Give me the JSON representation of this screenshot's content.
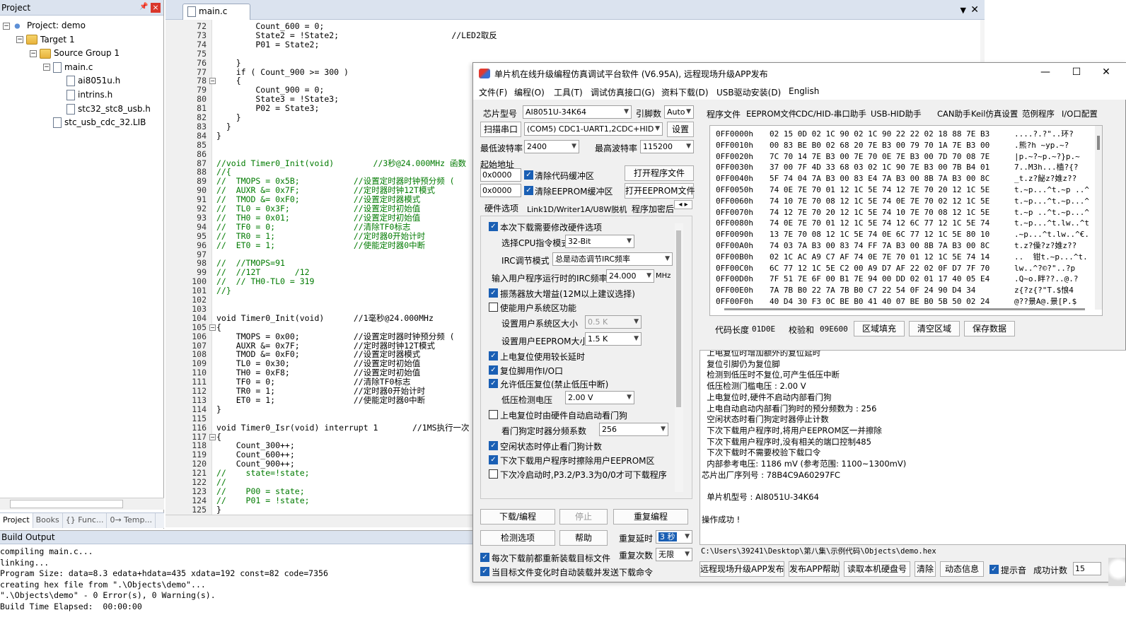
{
  "project_panel": {
    "title": "Project",
    "tree": [
      {
        "label": "Project: demo",
        "indent": 0,
        "exp": "−",
        "icon": "proj"
      },
      {
        "label": "Target 1",
        "indent": 1,
        "exp": "−",
        "icon": "folder"
      },
      {
        "label": "Source Group 1",
        "indent": 2,
        "exp": "−",
        "icon": "folder"
      },
      {
        "label": "main.c",
        "indent": 3,
        "exp": "−",
        "icon": "file"
      },
      {
        "label": "ai8051u.h",
        "indent": 4,
        "exp": "",
        "icon": "file"
      },
      {
        "label": "intrins.h",
        "indent": 4,
        "exp": "",
        "icon": "file"
      },
      {
        "label": "stc32_stc8_usb.h",
        "indent": 4,
        "exp": "",
        "icon": "file"
      },
      {
        "label": "stc_usb_cdc_32.LIB",
        "indent": 3,
        "exp": "",
        "icon": "file"
      }
    ],
    "tabs": [
      "Project",
      "Books",
      "{} Func...",
      "0→ Temp..."
    ]
  },
  "editor": {
    "tab": "main.c",
    "lines": [
      {
        "n": 72,
        "t": "        Count_600 = 0;"
      },
      {
        "n": 73,
        "t": "        State2 = !State2;                       //LED2取反",
        "c": 1
      },
      {
        "n": 74,
        "t": "        P01 = State2;"
      },
      {
        "n": 75,
        "t": ""
      },
      {
        "n": 76,
        "t": "    }"
      },
      {
        "n": 77,
        "t": "    if ( Count_900 >= 300 )",
        "k": 1
      },
      {
        "n": 78,
        "t": "    {",
        "f": 1
      },
      {
        "n": 79,
        "t": "        Count_900 = 0;"
      },
      {
        "n": 80,
        "t": "        State3 = !State3;"
      },
      {
        "n": 81,
        "t": "        P02 = State3;"
      },
      {
        "n": 82,
        "t": "    }"
      },
      {
        "n": 83,
        "t": "  }"
      },
      {
        "n": 84,
        "t": "}"
      },
      {
        "n": 85,
        "t": ""
      },
      {
        "n": 86,
        "t": ""
      },
      {
        "n": 87,
        "t": "//void Timer0_Init(void)        //3秒@24.000MHz 函数",
        "c": 2
      },
      {
        "n": 88,
        "t": "//{",
        "c": 2
      },
      {
        "n": 89,
        "t": "//  TMOPS = 0x5B;           //设置定时器时钟预分频 ( ",
        "c": 2
      },
      {
        "n": 90,
        "t": "//  AUXR &= 0x7F;           //定时器时钟12T模式",
        "c": 2
      },
      {
        "n": 91,
        "t": "//  TMOD &= 0xF0;           //设置定时器模式",
        "c": 2
      },
      {
        "n": 92,
        "t": "//  TL0 = 0x3F;             //设置定时初始值",
        "c": 2
      },
      {
        "n": 93,
        "t": "//  TH0 = 0x01;             //设置定时初始值",
        "c": 2
      },
      {
        "n": 94,
        "t": "//  TF0 = 0;                //清除TF0标志",
        "c": 2
      },
      {
        "n": 95,
        "t": "//  TR0 = 1;                //定时器0开始计时",
        "c": 2
      },
      {
        "n": 96,
        "t": "//  ET0 = 1;                //使能定时器0中断",
        "c": 2
      },
      {
        "n": 97,
        "t": ""
      },
      {
        "n": 98,
        "t": "//  //TMOPS=91",
        "c": 2
      },
      {
        "n": 99,
        "t": "//  //12T       /12",
        "c": 2
      },
      {
        "n": 100,
        "t": "//  // TH0-TL0 = 319",
        "c": 2
      },
      {
        "n": 101,
        "t": "//}",
        "c": 2
      },
      {
        "n": 102,
        "t": ""
      },
      {
        "n": 103,
        "t": ""
      },
      {
        "n": 104,
        "t": "void Timer0_Init(void)      //1毫秒@24.000MHz",
        "k": 2
      },
      {
        "n": 105,
        "t": "{",
        "f": 1
      },
      {
        "n": 106,
        "t": "    TMOPS = 0x00;           //设置定时器时钟预分频 ( ",
        "c": 1
      },
      {
        "n": 107,
        "t": "    AUXR &= 0x7F;           //定时器时钟12T模式",
        "c": 1
      },
      {
        "n": 108,
        "t": "    TMOD &= 0xF0;           //设置定时器模式",
        "c": 1
      },
      {
        "n": 109,
        "t": "    TL0 = 0x30;             //设置定时初始值",
        "c": 1
      },
      {
        "n": 110,
        "t": "    TH0 = 0xF8;             //设置定时初始值",
        "c": 1
      },
      {
        "n": 111,
        "t": "    TF0 = 0;                //清除TF0标志",
        "c": 1
      },
      {
        "n": 112,
        "t": "    TR0 = 1;                //定时器0开始计时",
        "c": 1
      },
      {
        "n": 113,
        "t": "    ET0 = 1;                //使能定时器0中断",
        "c": 1
      },
      {
        "n": 114,
        "t": "}"
      },
      {
        "n": 115,
        "t": ""
      },
      {
        "n": 116,
        "t": "void Timer0_Isr(void) interrupt 1       //1MS执行一次",
        "k": 2
      },
      {
        "n": 117,
        "t": "{",
        "f": 1
      },
      {
        "n": 118,
        "t": "    Count_300++;"
      },
      {
        "n": 119,
        "t": "    Count_600++;"
      },
      {
        "n": 120,
        "t": "    Count_900++;"
      },
      {
        "n": 121,
        "t": "//    state=!state;",
        "c": 2
      },
      {
        "n": 122,
        "t": "//",
        "c": 2
      },
      {
        "n": 123,
        "t": "//    P00 = state;",
        "c": 2
      },
      {
        "n": 124,
        "t": "//    P01 = !state;",
        "c": 2
      },
      {
        "n": 125,
        "t": "}"
      }
    ]
  },
  "build": {
    "title": "Build Output",
    "lines": [
      "compiling main.c...",
      "linking...",
      "Program Size: data=8.3 edata+hdata=435 xdata=192 const=82 code=7356",
      "creating hex file from \".\\Objects\\demo\"...",
      "\".\\Objects\\demo\" - 0 Error(s), 0 Warning(s).",
      "Build Time Elapsed:  00:00:00"
    ]
  },
  "isp": {
    "title": "单片机在线升级编程仿真调试平台软件 (V6.95A), 远程现场升级APP发布",
    "menu": [
      "文件(F)",
      "编程(O)",
      "工具(T)",
      "调试仿真接口(G)",
      "资料下载(D)",
      "USB驱动安装(D)",
      "English"
    ],
    "chip_label": "芯片型号",
    "chip_value": "AI8051U-34K64",
    "pin_label": "引脚数",
    "pin_value": "Auto",
    "scan_btn": "扫描串口",
    "port_value": "(COM5) CDC1-UART1,2CDC+HID",
    "settings_btn": "设置",
    "min_baud_label": "最低波特率",
    "min_baud_value": "2400",
    "max_baud_label": "最高波特率",
    "max_baud_value": "115200",
    "start_addr_label": "起始地址",
    "addr1": "0x0000",
    "addr2": "0x0000",
    "clear_code": "清除代码缓冲区",
    "clear_eeprom": "清除EEPROM缓冲区",
    "open_prog_btn": "打开程序文件",
    "open_eeprom_btn": "打开EEPROM文件",
    "hw_tabs": [
      "硬件选项",
      "Link1D/Writer1A/U8W脱机",
      "程序加密后"
    ],
    "opt_modify_hw": "本次下载需要修改硬件选项",
    "cpu_mode_label": "选择CPU指令模式",
    "cpu_mode_value": "32-Bit",
    "irc_mode_label": "IRC调节模式",
    "irc_mode_value": "总是动态调节IRC频率",
    "irc_freq_label": "输入用户程序运行时的IRC频率",
    "irc_freq_value": "24.000",
    "irc_freq_unit": "MHz",
    "osc_gain": "振荡器放大增益(12M以上建议选择)",
    "user_sys_area": "使能用户系统区功能",
    "sys_area_size_label": "设置用户系统区大小",
    "sys_area_size_value": "0.5 K",
    "eeprom_size_label": "设置用户EEPROM大小",
    "eeprom_size_value": "1.5 K",
    "long_reset": "上电复位使用较长延时",
    "reset_io": "复位脚用作I/O口",
    "lvr": "允许低压复位(禁止低压中断)",
    "lvd_label": "低压检测电压",
    "lvd_value": "2.00 V",
    "wdt_auto": "上电复位时由硬件自动启动看门狗",
    "wdt_div_label": "看门狗定时器分频系数",
    "wdt_div_value": "256",
    "idle_wdt": "空闲状态时停止看门狗计数",
    "erase_eeprom": "下次下载用户程序时擦除用户EEPROM区",
    "cold_boot": "下次冷启动时,P3.2/P3.3为0/0才可下载程序",
    "download_btn": "下载/编程",
    "stop_btn": "停止",
    "reprogram_btn": "重复编程",
    "check_btn": "检测选项",
    "help_btn": "帮助",
    "repeat_delay_label": "重复延时",
    "repeat_delay_value": "3 秒",
    "repeat_count_label": "重复次数",
    "repeat_count_value": "无限",
    "reload_each": "每次下载前都重新装载目标文件",
    "auto_send": "当目标文件变化时自动装载并发送下载命令",
    "right_tabs": [
      "程序文件",
      "EEPROM文件",
      "CDC/HID-串口助手",
      "USB-HID助手",
      "CAN助手",
      "Keil仿真设置",
      "范例程序",
      "I/O口配置"
    ],
    "hex_rows": [
      {
        "a": "0FF0000h",
        "h": "02 15 0D 02 1C 90 02 1C 90 22 22 02 18 88 7E B3",
        "s": "....?.?\"..环?"
      },
      {
        "a": "0FF0010h",
        "h": "00 83 BE B0 02 68 20 7E B3 00 79 70 1A 7E B3 00",
        "s": ".熊?h ~yp.~?"
      },
      {
        "a": "0FF0020h",
        "h": "7C 70 14 7E B3 00 7E 70 0E 7E B3 00 7D 70 08 7E",
        "s": "|p.~?~p.~?}p.~"
      },
      {
        "a": "0FF0030h",
        "h": "37 00 7F 4D 33 68 03 02 1C 90 7E B3 00 7B B4 01",
        "s": "7..M3h...樯?{?"
      },
      {
        "a": "0FF0040h",
        "h": "5F 74 04 7A B3 00 83 E4 7A B3 00 8B 7A B3 00 8C",
        "s": "_t.z?飶z?婎z??"
      },
      {
        "a": "0FF0050h",
        "h": "74 0E 7E 70 01 12 1C 5E 74 12 7E 70 20 12 1C 5E",
        "s": "t.~p...^t.~p ..^"
      },
      {
        "a": "0FF0060h",
        "h": "74 10 7E 70 08 12 1C 5E 74 0E 7E 70 02 12 1C 5E",
        "s": "t.~p...^t.~p...^"
      },
      {
        "a": "0FF0070h",
        "h": "74 12 7E 70 20 12 1C 5E 74 10 7E 70 08 12 1C 5E",
        "s": "t.~p ..^t.~p...^"
      },
      {
        "a": "0FF0080h",
        "h": "74 0E 7E 70 01 12 1C 5E 74 12 6C 77 12 1C 5E 74",
        "s": "t.~p...^t.lw..^t"
      },
      {
        "a": "0FF0090h",
        "h": "13 7E 70 08 12 1C 5E 74 0E 6C 77 12 1C 5E 80 10",
        "s": ".~p...^t.lw..^€."
      },
      {
        "a": "0FF00A0h",
        "h": "74 03 7A B3 00 83 74 FF 7A B3 00 8B 7A B3 00 8C",
        "s": "t.z?僺?z?婎z??"
      },
      {
        "a": "0FF00B0h",
        "h": "02 1C AC A9 C7 AF 74 0E 7E 70 01 12 1C 5E 74 14",
        "s": "..  钳t.~p...^t."
      },
      {
        "a": "0FF00C0h",
        "h": "6C 77 12 1C 5E C2 00 A9 D7 AF 22 02 0F D7 7F 70",
        "s": "lw..^?©?\"..?p"
      },
      {
        "a": "0FF00D0h",
        "h": "7F 51 7E 6F 00 B1 7E 94 00 DD 02 01 17 40 05 E4",
        "s": ".Q~o.眫??..@.?"
      },
      {
        "a": "0FF00E0h",
        "h": "7A 7B B0 22 7A 7B B0 C7 22 54 0F 24 90 D4 34",
        "s": "z{?z{?\"T.$悢4"
      },
      {
        "a": "0FF00F0h",
        "h": "40 D4 30 F3 0C BE B0 41 40 07 BE B0 5B 50 02 24",
        "s": "@??景A@.景[P.$"
      }
    ],
    "code_len_label": "代码长度",
    "code_len_value": "01D0E",
    "checksum_label": "校验和",
    "checksum_value": "09E600",
    "fill_btn": "区域填充",
    "clear_area_btn": "清空区域",
    "save_btn": "保存数据",
    "log_lines": [
      "  上电复位时增加额外的复位延时",
      "  复位引脚仍为复位脚",
      "  检测到低压时不复位,可产生低压中断",
      "  低压检测门槛电压 : 2.00 V",
      "  上电复位时,硬件不启动内部看门狗",
      "  上电自动启动内部看门狗时的预分频数为 : 256",
      "  空闲状态时看门狗定时器停止计数",
      "  下次下载用户程序时,将用户EEPROM区一并擦除",
      "  下次下载用户程序时,没有相关的端口控制485",
      "  下次下载时不需要校验下载口令",
      "  内部参考电压: 1186 mV (参考范围: 1100~1300mV)",
      "芯片出厂序列号 : 78B4C9A60297FC",
      "",
      "  单片机型号 : AI8051U-34K64",
      "",
      "操作成功 !"
    ],
    "path": "C:\\Users\\39241\\Desktop\\第八集\\示例代码\\Objects\\demo.hex",
    "bottom_btns": [
      "远程现场升级APP发布",
      "发布APP帮助",
      "读取本机硬盘号",
      "清除",
      "动态信息"
    ],
    "beep_label": "提示音",
    "success_label": "成功计数",
    "success_value": "15"
  }
}
